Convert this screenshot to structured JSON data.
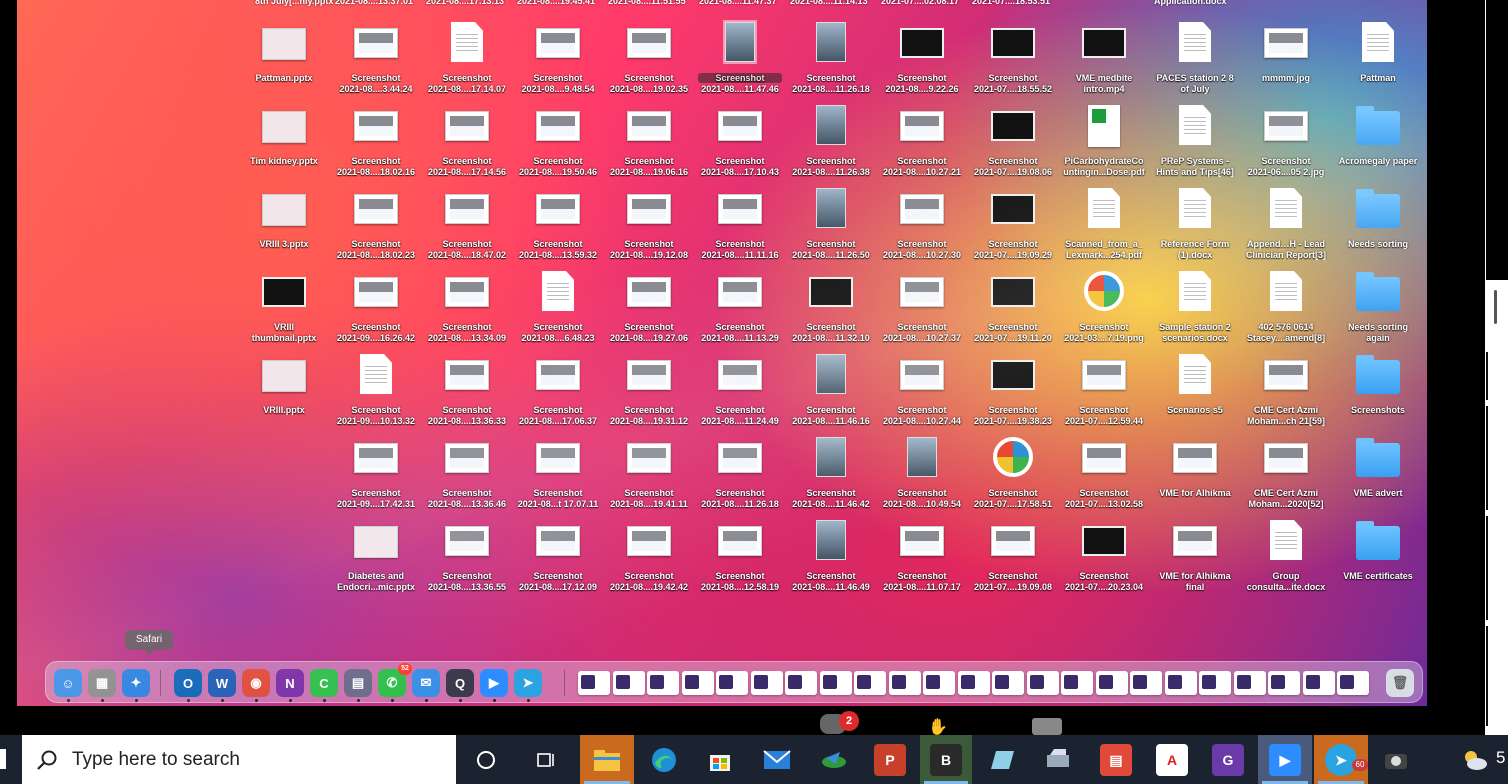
{
  "tooltip": "Safari",
  "search": {
    "placeholder": "Type here to search"
  },
  "top_row_labels": [
    "8th July[...nly.pptx",
    "2021-08....13.37.01",
    "2021-08....17.13.13",
    "2021-08....19.45.41",
    "2021-08....11.51.55",
    "2021-08....11.47.37",
    "2021-08....11.14.13",
    "2021-07....02.08.17",
    "2021-07....18.53.51",
    "Application.docx"
  ],
  "desktop_columns": [
    {
      "items": [
        {
          "l1": "Pattman.pptx",
          "l2": "",
          "kind": "slide"
        },
        {
          "l1": "Tim kidney.pptx",
          "l2": "",
          "kind": "slide"
        },
        {
          "l1": "VRIII 3.pptx",
          "l2": "",
          "kind": "slide"
        },
        {
          "l1": "VRIII",
          "l2": "thumbnail.pptx",
          "kind": "video"
        },
        {
          "l1": "VRIII.pptx",
          "l2": "",
          "kind": "slide"
        },
        {
          "l1": "",
          "l2": "",
          "kind": "none"
        },
        {
          "l1": "",
          "l2": "",
          "kind": "none"
        }
      ]
    },
    {
      "items": [
        {
          "l1": "Screenshot",
          "l2": "2021-08....3.44.24",
          "kind": "shot"
        },
        {
          "l1": "Screenshot",
          "l2": "2021-08....18.02.16",
          "kind": "shot"
        },
        {
          "l1": "Screenshot",
          "l2": "2021-08....18.02.23",
          "kind": "shot"
        },
        {
          "l1": "Screenshot",
          "l2": "2021-09....16.26.42",
          "kind": "shot"
        },
        {
          "l1": "Screenshot",
          "l2": "2021-09....10.13.32",
          "kind": "doc"
        },
        {
          "l1": "Screenshot",
          "l2": "2021-09....17.42.31",
          "kind": "shot"
        },
        {
          "l1": "Diabetes and",
          "l2": "Endocri...mic.pptx",
          "kind": "slide"
        }
      ]
    },
    {
      "items": [
        {
          "l1": "Screenshot",
          "l2": "2021-08....17.14.07",
          "kind": "doc"
        },
        {
          "l1": "Screenshot",
          "l2": "2021-08....17.14.56",
          "kind": "shot"
        },
        {
          "l1": "Screenshot",
          "l2": "2021-08....18.47.02",
          "kind": "shot"
        },
        {
          "l1": "Screenshot",
          "l2": "2021-08....13.34.09",
          "kind": "shot"
        },
        {
          "l1": "Screenshot",
          "l2": "2021-08....13.36.33",
          "kind": "shot"
        },
        {
          "l1": "Screenshot",
          "l2": "2021-08....13.36.46",
          "kind": "shot"
        },
        {
          "l1": "Screenshot",
          "l2": "2021-08....13.36.55",
          "kind": "shot"
        }
      ]
    },
    {
      "items": [
        {
          "l1": "Screenshot",
          "l2": "2021-08....9.48.54",
          "kind": "shot"
        },
        {
          "l1": "Screenshot",
          "l2": "2021-08....19.50.46",
          "kind": "shot"
        },
        {
          "l1": "Screenshot",
          "l2": "2021-08....13.59.32",
          "kind": "shot"
        },
        {
          "l1": "Screenshot",
          "l2": "2021-08....6.48.23",
          "kind": "doc"
        },
        {
          "l1": "Screenshot",
          "l2": "2021-08....17.06.37",
          "kind": "shot"
        },
        {
          "l1": "Screenshot",
          "l2": "2021-08...t 17.07.11",
          "kind": "shot"
        },
        {
          "l1": "Screenshot",
          "l2": "2021-08....17.12.09",
          "kind": "shot"
        }
      ]
    },
    {
      "items": [
        {
          "l1": "Screenshot",
          "l2": "2021-08....19.02.35",
          "kind": "shot"
        },
        {
          "l1": "Screenshot",
          "l2": "2021-08....19.06.16",
          "kind": "shot"
        },
        {
          "l1": "Screenshot",
          "l2": "2021-08....19.12.08",
          "kind": "shot"
        },
        {
          "l1": "Screenshot",
          "l2": "2021-08....19.27.06",
          "kind": "shot"
        },
        {
          "l1": "Screenshot",
          "l2": "2021-08....19.31.12",
          "kind": "shot"
        },
        {
          "l1": "Screenshot",
          "l2": "2021-08....19.41.11",
          "kind": "shot"
        },
        {
          "l1": "Screenshot",
          "l2": "2021-08....19.42.42",
          "kind": "shot"
        }
      ]
    },
    {
      "items": [
        {
          "l1": "Screenshot",
          "l2": "2021-08....11.47.46",
          "kind": "photo",
          "selected": true
        },
        {
          "l1": "Screenshot",
          "l2": "2021-08....17.10.43",
          "kind": "shot"
        },
        {
          "l1": "Screenshot",
          "l2": "2021-08....11.11.16",
          "kind": "shot"
        },
        {
          "l1": "Screenshot",
          "l2": "2021-08....11.13.29",
          "kind": "shot"
        },
        {
          "l1": "Screenshot",
          "l2": "2021-08....11.24.49",
          "kind": "shot"
        },
        {
          "l1": "Screenshot",
          "l2": "2021-08....11.26.18",
          "kind": "shot"
        },
        {
          "l1": "Screenshot",
          "l2": "2021-08....12.58.19",
          "kind": "shot"
        }
      ]
    },
    {
      "items": [
        {
          "l1": "Screenshot",
          "l2": "2021-08....11.26.18",
          "kind": "photo"
        },
        {
          "l1": "Screenshot",
          "l2": "2021-08....11.26.38",
          "kind": "photo"
        },
        {
          "l1": "Screenshot",
          "l2": "2021-08....11.26.50",
          "kind": "photo"
        },
        {
          "l1": "Screenshot",
          "l2": "2021-08....11.32.10",
          "kind": "video"
        },
        {
          "l1": "Screenshot",
          "l2": "2021-08....11.46.16",
          "kind": "photo"
        },
        {
          "l1": "Screenshot",
          "l2": "2021-08....11.46.42",
          "kind": "photo"
        },
        {
          "l1": "Screenshot",
          "l2": "2021-08....11.46.49",
          "kind": "photo"
        }
      ]
    },
    {
      "items": [
        {
          "l1": "Screenshot",
          "l2": "2021-08....9.22.26",
          "kind": "video"
        },
        {
          "l1": "Screenshot",
          "l2": "2021-08....10.27.21",
          "kind": "shot"
        },
        {
          "l1": "Screenshot",
          "l2": "2021-08....10.27.30",
          "kind": "shot"
        },
        {
          "l1": "Screenshot",
          "l2": "2021-08....10.27.37",
          "kind": "shot"
        },
        {
          "l1": "Screenshot",
          "l2": "2021-08....10.27.44",
          "kind": "shot"
        },
        {
          "l1": "Screenshot",
          "l2": "2021-08....10.49.54",
          "kind": "photo"
        },
        {
          "l1": "Screenshot",
          "l2": "2021-08....11.07.17",
          "kind": "shot"
        }
      ]
    },
    {
      "items": [
        {
          "l1": "Screenshot",
          "l2": "2021-07....18.55.52",
          "kind": "video"
        },
        {
          "l1": "Screenshot",
          "l2": "2021-07....19.08.06",
          "kind": "video"
        },
        {
          "l1": "Screenshot",
          "l2": "2021-07....19.09.29",
          "kind": "video"
        },
        {
          "l1": "Screenshot",
          "l2": "2021-07....19.11.20",
          "kind": "video"
        },
        {
          "l1": "Screenshot",
          "l2": "2021-07....19.38.23",
          "kind": "video"
        },
        {
          "l1": "Screenshot",
          "l2": "2021-07....17.58.51",
          "kind": "png"
        },
        {
          "l1": "Screenshot",
          "l2": "2021-07....19.09.08",
          "kind": "shot"
        }
      ]
    },
    {
      "items": [
        {
          "l1": "VME medbite",
          "l2": "intro.mp4",
          "kind": "video"
        },
        {
          "l1": "PiCarbohydrateCo",
          "l2": "untingin...Dose.pdf",
          "kind": "pdf"
        },
        {
          "l1": "Scanned_from_a_",
          "l2": "Lexmark...254.pdf",
          "kind": "doc"
        },
        {
          "l1": "Screenshot",
          "l2": "2021-03....7.19.png",
          "kind": "png"
        },
        {
          "l1": "Screenshot",
          "l2": "2021-07....12.59.44",
          "kind": "shot"
        },
        {
          "l1": "Screenshot",
          "l2": "2021-07....13.02.58",
          "kind": "shot"
        },
        {
          "l1": "Screenshot",
          "l2": "2021-07....20.23.04",
          "kind": "video"
        }
      ]
    },
    {
      "items": [
        {
          "l1": "PACES station 2 8",
          "l2": "of July",
          "kind": "doc"
        },
        {
          "l1": "PReP Systems -",
          "l2": "Hints and Tips[46]",
          "kind": "doc"
        },
        {
          "l1": "Reference Form",
          "l2": "(1).docx",
          "kind": "doc"
        },
        {
          "l1": "Sample station 2",
          "l2": "scenarios.docx",
          "kind": "doc"
        },
        {
          "l1": "Scenarios s5",
          "l2": "",
          "kind": "doc"
        },
        {
          "l1": "VME for Alhikma",
          "l2": "",
          "kind": "shot"
        },
        {
          "l1": "VME for Alhikma",
          "l2": "final",
          "kind": "shot"
        }
      ]
    },
    {
      "items": [
        {
          "l1": "mmmm.jpg",
          "l2": "",
          "kind": "shot"
        },
        {
          "l1": "Screenshot",
          "l2": "2021-06....05 2.jpg",
          "kind": "shot"
        },
        {
          "l1": "Append…H - Lead",
          "l2": "Clinician Report[3]",
          "kind": "doc"
        },
        {
          "l1": "402 576 0614",
          "l2": "Stacey....amend[8]",
          "kind": "doc"
        },
        {
          "l1": "CME Cert Azmi",
          "l2": "Moham...ch 21[59]",
          "kind": "shot"
        },
        {
          "l1": "CME Cert Azmi",
          "l2": "Moham...2020[52]",
          "kind": "shot"
        },
        {
          "l1": "Group",
          "l2": "consulta...ite.docx",
          "kind": "doc"
        }
      ]
    },
    {
      "items": [
        {
          "l1": "Pattman",
          "l2": "",
          "kind": "doc"
        },
        {
          "l1": "Acromegaly paper",
          "l2": "",
          "kind": "folder"
        },
        {
          "l1": "Needs sorting",
          "l2": "",
          "kind": "folder"
        },
        {
          "l1": "Needs sorting",
          "l2": "again",
          "kind": "folder"
        },
        {
          "l1": "Screenshots",
          "l2": "",
          "kind": "folder"
        },
        {
          "l1": "VME advert",
          "l2": "",
          "kind": "folder"
        },
        {
          "l1": "VME certificates",
          "l2": "",
          "kind": "folder"
        }
      ]
    }
  ],
  "dock": {
    "apps": [
      {
        "name": "finder-icon",
        "color": "#3b8fe6",
        "glyph": "☺"
      },
      {
        "name": "launchpad-icon",
        "color": "#8a8a8a",
        "glyph": "▦"
      },
      {
        "name": "safari-icon",
        "color": "#2a7fe0",
        "glyph": "✦"
      },
      {
        "name": "outlook-icon",
        "color": "#0a64b8",
        "glyph": "O"
      },
      {
        "name": "word-icon",
        "color": "#1f5bb5",
        "glyph": "W"
      },
      {
        "name": "chrome-icon",
        "color": "#e04a3a",
        "glyph": "◉"
      },
      {
        "name": "onenote-icon",
        "color": "#7a2fa8",
        "glyph": "N"
      },
      {
        "name": "facetime-icon",
        "color": "#2fbf4a",
        "glyph": "C"
      },
      {
        "name": "preview-icon",
        "color": "#6b6b8a",
        "glyph": "▤"
      },
      {
        "name": "whatsapp-icon",
        "color": "#2fbf4a",
        "glyph": "✆",
        "badge": "52"
      },
      {
        "name": "mail-icon",
        "color": "#3a8fe6",
        "glyph": "✉"
      },
      {
        "name": "quicktime-icon",
        "color": "#3a3a4a",
        "glyph": "Q"
      },
      {
        "name": "zoom-icon",
        "color": "#2d8cff",
        "glyph": "▶"
      },
      {
        "name": "telegram-icon",
        "color": "#2aa3e0",
        "glyph": "➤"
      }
    ]
  },
  "taskbar": {
    "zoom_badge": "60",
    "float_badge": "2",
    "clock_fragment": "5"
  }
}
